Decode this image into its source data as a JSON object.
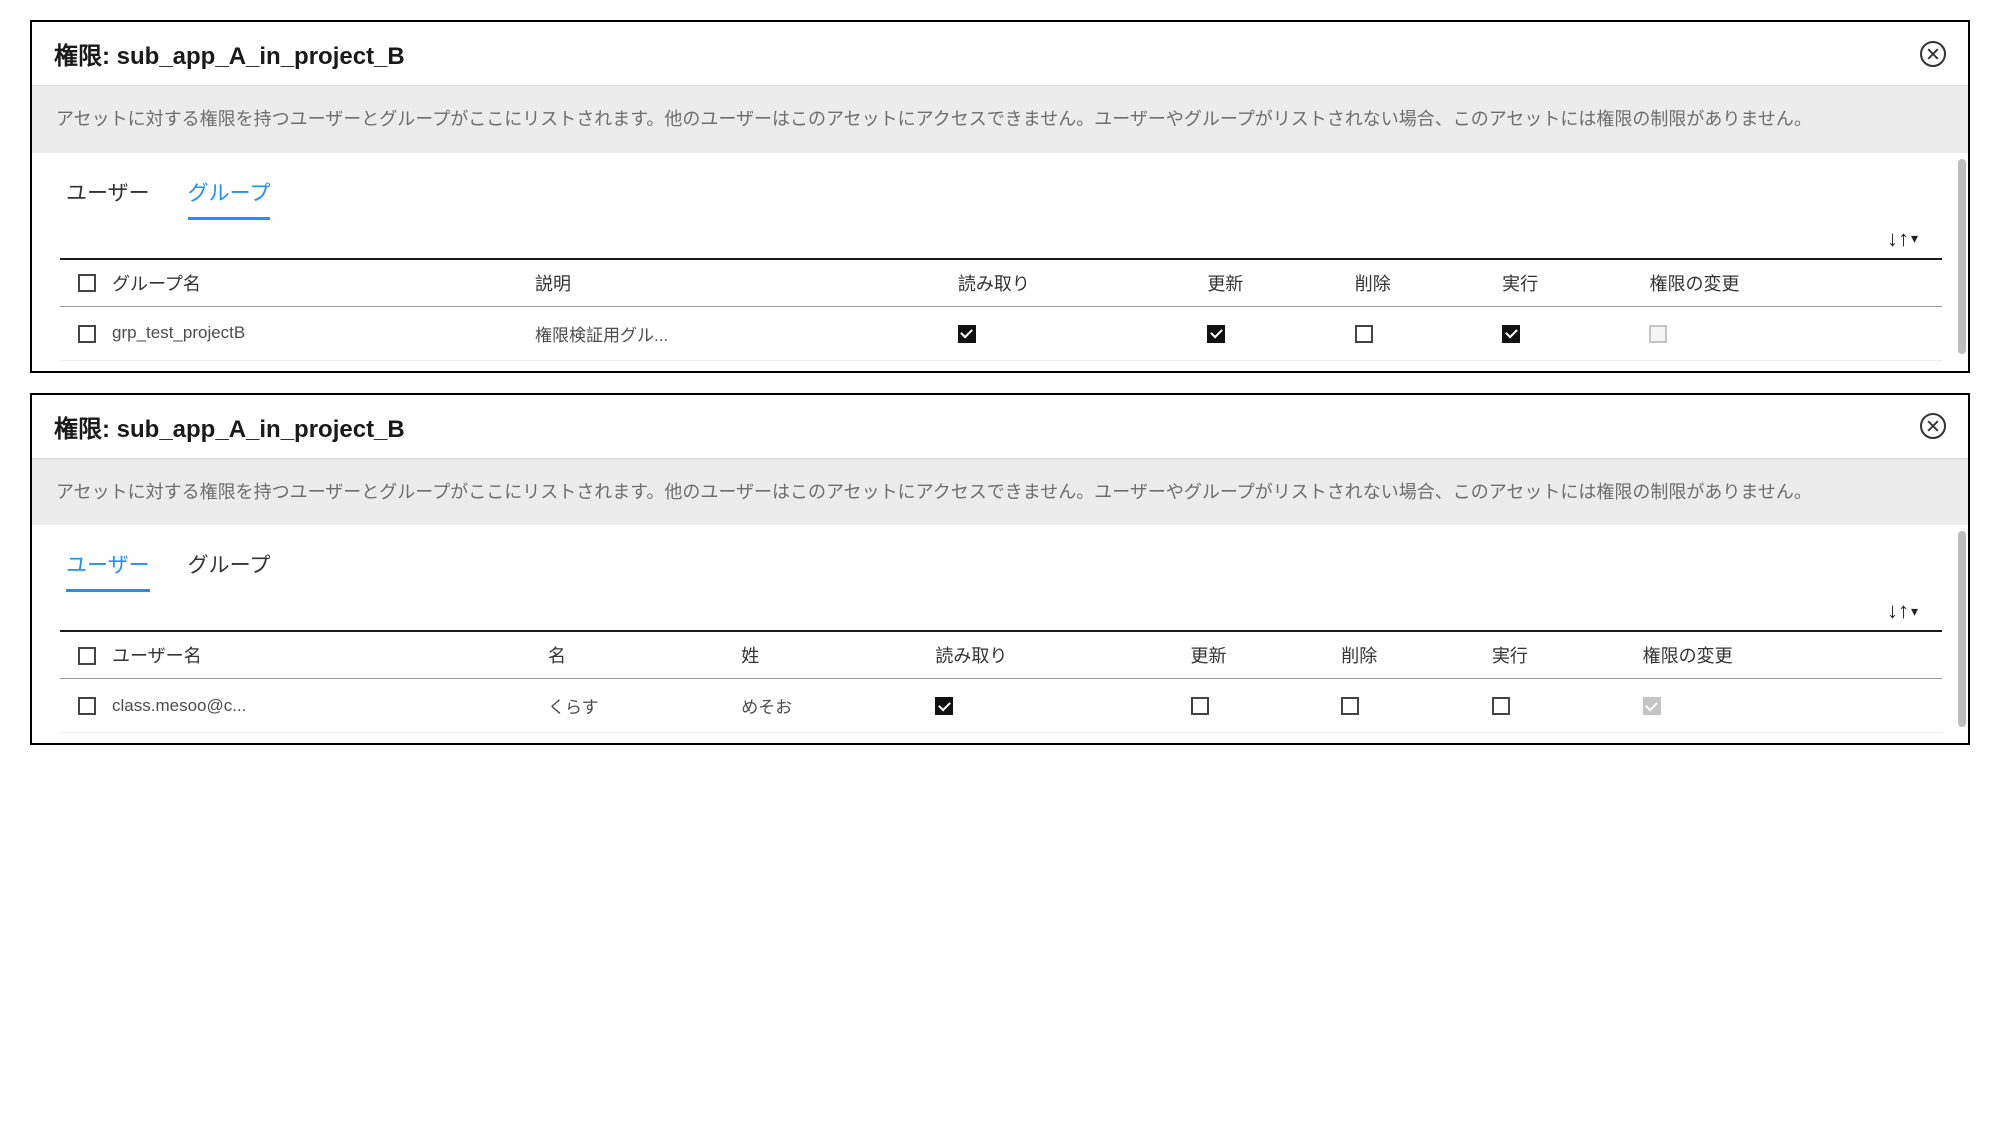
{
  "panels": [
    {
      "title": "権限: sub_app_A_in_project_B",
      "description": "アセットに対する権限を持つユーザーとグループがここにリストされます。他のユーザーはこのアセットにアクセスできません。ユーザーやグループがリストされない場合、このアセットには権限の制限がありません。",
      "tabs": {
        "user": "ユーザー",
        "group": "グループ",
        "active": "group"
      },
      "columns": {
        "c0": "グループ名",
        "c1": "説明",
        "c2": "読み取り",
        "c3": "更新",
        "c4": "削除",
        "c5": "実行",
        "c6": "権限の変更"
      },
      "row": {
        "name": "grp_test_projectB",
        "desc": "権限検証用グル...",
        "read": true,
        "update": true,
        "delete": false,
        "execute": true,
        "changeperm": false,
        "changeperm_disabled": true
      }
    },
    {
      "title": "権限: sub_app_A_in_project_B",
      "description": "アセットに対する権限を持つユーザーとグループがここにリストされます。他のユーザーはこのアセットにアクセスできません。ユーザーやグループがリストされない場合、このアセットには権限の制限がありません。",
      "tabs": {
        "user": "ユーザー",
        "group": "グループ",
        "active": "user"
      },
      "columns": {
        "c0": "ユーザー名",
        "c1": "名",
        "c2": "姓",
        "c3": "読み取り",
        "c4": "更新",
        "c5": "削除",
        "c6": "実行",
        "c7": "権限の変更"
      },
      "row": {
        "username": "class.mesoo@c...",
        "firstname": "くらす",
        "lastname": "めそお",
        "read": true,
        "update": false,
        "delete": false,
        "execute": false,
        "changeperm": true,
        "changeperm_disabled": true
      }
    }
  ]
}
